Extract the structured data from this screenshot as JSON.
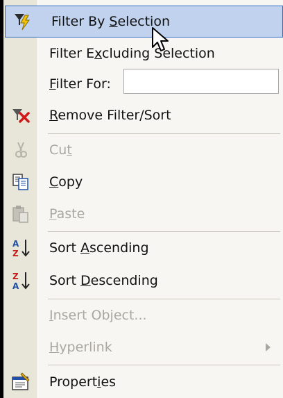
{
  "menu": {
    "filter_by_selection": {
      "pre": "Filter By ",
      "u": "S",
      "post": "election",
      "icon": "filter-lightning-icon"
    },
    "filter_excluding": {
      "pre": "Filter E",
      "u": "x",
      "post": "cluding Selection"
    },
    "filter_for": {
      "pre": "",
      "u": "F",
      "post": "ilter For:",
      "input_value": ""
    },
    "remove_filter": {
      "pre": "",
      "u": "R",
      "post": "emove Filter/Sort",
      "icon": "remove-filter-icon"
    },
    "cut": {
      "pre": "Cu",
      "u": "t",
      "post": "",
      "icon": "scissors-icon",
      "disabled": true
    },
    "copy": {
      "pre": "",
      "u": "C",
      "post": "opy",
      "icon": "copy-icon"
    },
    "paste": {
      "pre": "",
      "u": "P",
      "post": "aste",
      "icon": "paste-icon",
      "disabled": true
    },
    "sort_asc": {
      "pre": "Sort ",
      "u": "A",
      "post": "scending",
      "icon": "sort-ascending-icon"
    },
    "sort_desc": {
      "pre": "Sort ",
      "u": "D",
      "post": "escending",
      "icon": "sort-descending-icon"
    },
    "insert_object": {
      "pre": "",
      "u": "I",
      "post": "nsert Object...",
      "disabled": true
    },
    "hyperlink": {
      "pre": "",
      "u": "H",
      "post": "yperlink",
      "disabled": true,
      "submenu": true
    },
    "properties": {
      "pre": "Propert",
      "u": "i",
      "post": "es",
      "icon": "properties-icon"
    }
  },
  "colors": {
    "highlight": "#c1d2ee",
    "highlight_border": "#316ac5",
    "gutter": "#e8e6d8",
    "menu_bg": "#f7f6f2",
    "disabled": "#a9a8a0"
  }
}
